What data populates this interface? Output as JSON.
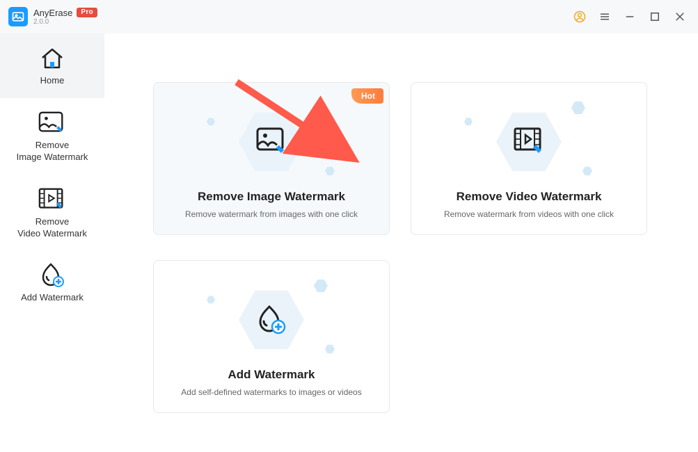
{
  "app": {
    "name": "AnyErase",
    "version": "2.0.0",
    "pro_label": "Pro"
  },
  "sidebar": {
    "items": [
      {
        "label": "Home"
      },
      {
        "label": "Remove\nImage Watermark"
      },
      {
        "label": "Remove\nVideo Watermark"
      },
      {
        "label": "Add Watermark"
      }
    ]
  },
  "cards": {
    "remove_image": {
      "title": "Remove Image Watermark",
      "desc": "Remove watermark from images with one click",
      "badge": "Hot"
    },
    "remove_video": {
      "title": "Remove Video Watermark",
      "desc": "Remove watermark from videos with one click"
    },
    "add_watermark": {
      "title": "Add Watermark",
      "desc": "Add self-defined watermarks to images or videos"
    }
  }
}
